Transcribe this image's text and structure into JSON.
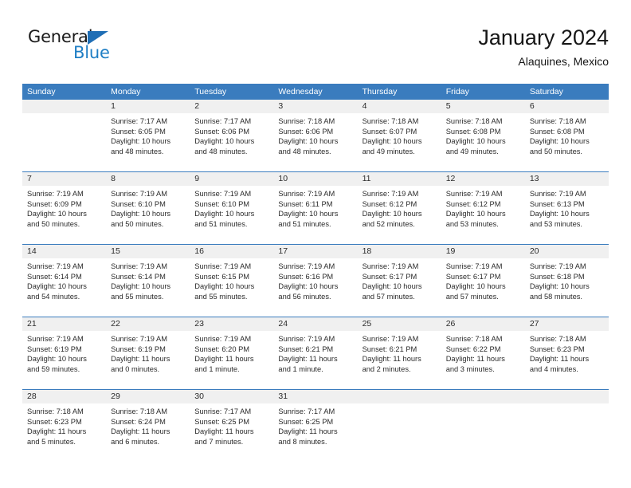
{
  "brand": {
    "name_top": "General",
    "name_bottom": "Blue",
    "triangle_color": "#1f6eb5",
    "blue_color": "#1f7ec4"
  },
  "header": {
    "title": "January 2024",
    "subtitle": "Alaquines, Mexico"
  },
  "theme": {
    "header_bg": "#3a7cbe",
    "daynum_bg": "#f0f0f0",
    "text": "#2b2b2b"
  },
  "weekdays": [
    "Sunday",
    "Monday",
    "Tuesday",
    "Wednesday",
    "Thursday",
    "Friday",
    "Saturday"
  ],
  "weeks": [
    [
      {
        "num": "",
        "sunrise": "",
        "sunset": "",
        "daylight1": "",
        "daylight2": ""
      },
      {
        "num": "1",
        "sunrise": "Sunrise: 7:17 AM",
        "sunset": "Sunset: 6:05 PM",
        "daylight1": "Daylight: 10 hours",
        "daylight2": "and 48 minutes."
      },
      {
        "num": "2",
        "sunrise": "Sunrise: 7:17 AM",
        "sunset": "Sunset: 6:06 PM",
        "daylight1": "Daylight: 10 hours",
        "daylight2": "and 48 minutes."
      },
      {
        "num": "3",
        "sunrise": "Sunrise: 7:18 AM",
        "sunset": "Sunset: 6:06 PM",
        "daylight1": "Daylight: 10 hours",
        "daylight2": "and 48 minutes."
      },
      {
        "num": "4",
        "sunrise": "Sunrise: 7:18 AM",
        "sunset": "Sunset: 6:07 PM",
        "daylight1": "Daylight: 10 hours",
        "daylight2": "and 49 minutes."
      },
      {
        "num": "5",
        "sunrise": "Sunrise: 7:18 AM",
        "sunset": "Sunset: 6:08 PM",
        "daylight1": "Daylight: 10 hours",
        "daylight2": "and 49 minutes."
      },
      {
        "num": "6",
        "sunrise": "Sunrise: 7:18 AM",
        "sunset": "Sunset: 6:08 PM",
        "daylight1": "Daylight: 10 hours",
        "daylight2": "and 50 minutes."
      }
    ],
    [
      {
        "num": "7",
        "sunrise": "Sunrise: 7:19 AM",
        "sunset": "Sunset: 6:09 PM",
        "daylight1": "Daylight: 10 hours",
        "daylight2": "and 50 minutes."
      },
      {
        "num": "8",
        "sunrise": "Sunrise: 7:19 AM",
        "sunset": "Sunset: 6:10 PM",
        "daylight1": "Daylight: 10 hours",
        "daylight2": "and 50 minutes."
      },
      {
        "num": "9",
        "sunrise": "Sunrise: 7:19 AM",
        "sunset": "Sunset: 6:10 PM",
        "daylight1": "Daylight: 10 hours",
        "daylight2": "and 51 minutes."
      },
      {
        "num": "10",
        "sunrise": "Sunrise: 7:19 AM",
        "sunset": "Sunset: 6:11 PM",
        "daylight1": "Daylight: 10 hours",
        "daylight2": "and 51 minutes."
      },
      {
        "num": "11",
        "sunrise": "Sunrise: 7:19 AM",
        "sunset": "Sunset: 6:12 PM",
        "daylight1": "Daylight: 10 hours",
        "daylight2": "and 52 minutes."
      },
      {
        "num": "12",
        "sunrise": "Sunrise: 7:19 AM",
        "sunset": "Sunset: 6:12 PM",
        "daylight1": "Daylight: 10 hours",
        "daylight2": "and 53 minutes."
      },
      {
        "num": "13",
        "sunrise": "Sunrise: 7:19 AM",
        "sunset": "Sunset: 6:13 PM",
        "daylight1": "Daylight: 10 hours",
        "daylight2": "and 53 minutes."
      }
    ],
    [
      {
        "num": "14",
        "sunrise": "Sunrise: 7:19 AM",
        "sunset": "Sunset: 6:14 PM",
        "daylight1": "Daylight: 10 hours",
        "daylight2": "and 54 minutes."
      },
      {
        "num": "15",
        "sunrise": "Sunrise: 7:19 AM",
        "sunset": "Sunset: 6:14 PM",
        "daylight1": "Daylight: 10 hours",
        "daylight2": "and 55 minutes."
      },
      {
        "num": "16",
        "sunrise": "Sunrise: 7:19 AM",
        "sunset": "Sunset: 6:15 PM",
        "daylight1": "Daylight: 10 hours",
        "daylight2": "and 55 minutes."
      },
      {
        "num": "17",
        "sunrise": "Sunrise: 7:19 AM",
        "sunset": "Sunset: 6:16 PM",
        "daylight1": "Daylight: 10 hours",
        "daylight2": "and 56 minutes."
      },
      {
        "num": "18",
        "sunrise": "Sunrise: 7:19 AM",
        "sunset": "Sunset: 6:17 PM",
        "daylight1": "Daylight: 10 hours",
        "daylight2": "and 57 minutes."
      },
      {
        "num": "19",
        "sunrise": "Sunrise: 7:19 AM",
        "sunset": "Sunset: 6:17 PM",
        "daylight1": "Daylight: 10 hours",
        "daylight2": "and 57 minutes."
      },
      {
        "num": "20",
        "sunrise": "Sunrise: 7:19 AM",
        "sunset": "Sunset: 6:18 PM",
        "daylight1": "Daylight: 10 hours",
        "daylight2": "and 58 minutes."
      }
    ],
    [
      {
        "num": "21",
        "sunrise": "Sunrise: 7:19 AM",
        "sunset": "Sunset: 6:19 PM",
        "daylight1": "Daylight: 10 hours",
        "daylight2": "and 59 minutes."
      },
      {
        "num": "22",
        "sunrise": "Sunrise: 7:19 AM",
        "sunset": "Sunset: 6:19 PM",
        "daylight1": "Daylight: 11 hours",
        "daylight2": "and 0 minutes."
      },
      {
        "num": "23",
        "sunrise": "Sunrise: 7:19 AM",
        "sunset": "Sunset: 6:20 PM",
        "daylight1": "Daylight: 11 hours",
        "daylight2": "and 1 minute."
      },
      {
        "num": "24",
        "sunrise": "Sunrise: 7:19 AM",
        "sunset": "Sunset: 6:21 PM",
        "daylight1": "Daylight: 11 hours",
        "daylight2": "and 1 minute."
      },
      {
        "num": "25",
        "sunrise": "Sunrise: 7:19 AM",
        "sunset": "Sunset: 6:21 PM",
        "daylight1": "Daylight: 11 hours",
        "daylight2": "and 2 minutes."
      },
      {
        "num": "26",
        "sunrise": "Sunrise: 7:18 AM",
        "sunset": "Sunset: 6:22 PM",
        "daylight1": "Daylight: 11 hours",
        "daylight2": "and 3 minutes."
      },
      {
        "num": "27",
        "sunrise": "Sunrise: 7:18 AM",
        "sunset": "Sunset: 6:23 PM",
        "daylight1": "Daylight: 11 hours",
        "daylight2": "and 4 minutes."
      }
    ],
    [
      {
        "num": "28",
        "sunrise": "Sunrise: 7:18 AM",
        "sunset": "Sunset: 6:23 PM",
        "daylight1": "Daylight: 11 hours",
        "daylight2": "and 5 minutes."
      },
      {
        "num": "29",
        "sunrise": "Sunrise: 7:18 AM",
        "sunset": "Sunset: 6:24 PM",
        "daylight1": "Daylight: 11 hours",
        "daylight2": "and 6 minutes."
      },
      {
        "num": "30",
        "sunrise": "Sunrise: 7:17 AM",
        "sunset": "Sunset: 6:25 PM",
        "daylight1": "Daylight: 11 hours",
        "daylight2": "and 7 minutes."
      },
      {
        "num": "31",
        "sunrise": "Sunrise: 7:17 AM",
        "sunset": "Sunset: 6:25 PM",
        "daylight1": "Daylight: 11 hours",
        "daylight2": "and 8 minutes."
      },
      {
        "num": "",
        "sunrise": "",
        "sunset": "",
        "daylight1": "",
        "daylight2": ""
      },
      {
        "num": "",
        "sunrise": "",
        "sunset": "",
        "daylight1": "",
        "daylight2": ""
      },
      {
        "num": "",
        "sunrise": "",
        "sunset": "",
        "daylight1": "",
        "daylight2": ""
      }
    ]
  ]
}
